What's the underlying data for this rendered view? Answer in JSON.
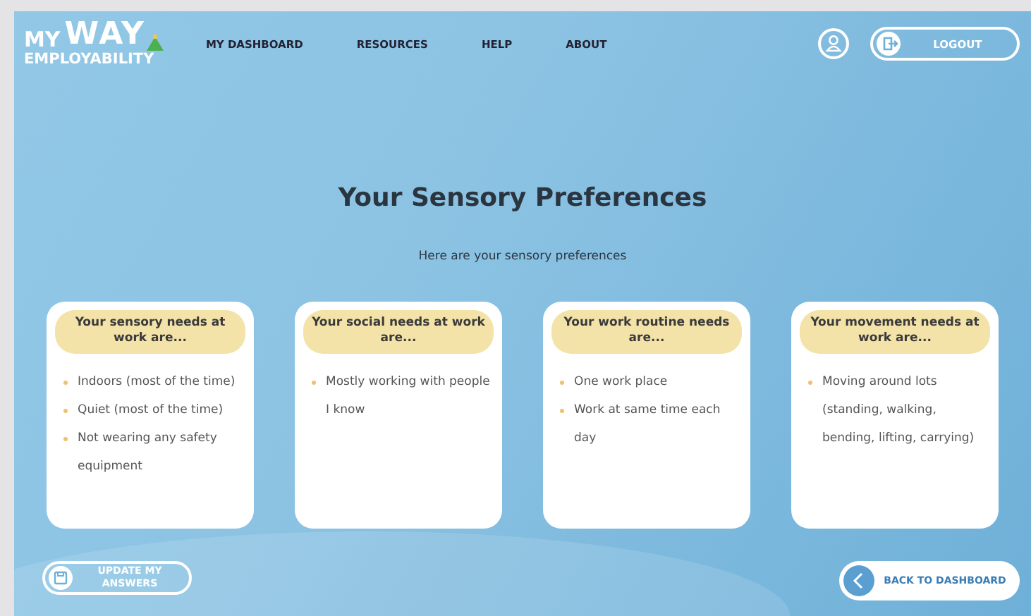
{
  "logo": {
    "line1_small": "MY",
    "line1_large": "WAY",
    "line2": "EMPLOYABILITY"
  },
  "nav": [
    {
      "label": "MY DASHBOARD"
    },
    {
      "label": "RESOURCES"
    },
    {
      "label": "HELP"
    },
    {
      "label": "ABOUT"
    }
  ],
  "logout_button": {
    "label": "LOGOUT"
  },
  "title": "Your Sensory Preferences",
  "subtitle": "Here are your sensory preferences",
  "cards": [
    {
      "heading": "Your sensory needs at work are...",
      "items": [
        "Indoors (most of the time)",
        "Quiet (most of the time)",
        "Not wearing any safety equipment"
      ]
    },
    {
      "heading": "Your social needs at work are...",
      "items": [
        "Mostly working with people I know"
      ]
    },
    {
      "heading": "Your work routine needs are...",
      "items": [
        "One work place",
        "Work at same time each day"
      ]
    },
    {
      "heading": "Your movement needs at work are...",
      "items": [
        "Moving around lots (standing, walking, bending, lifting, carrying)"
      ]
    }
  ],
  "update_button": {
    "label": "UPDATE MY ANSWERS"
  },
  "back_button": {
    "label": "BACK TO DASHBOARD"
  }
}
